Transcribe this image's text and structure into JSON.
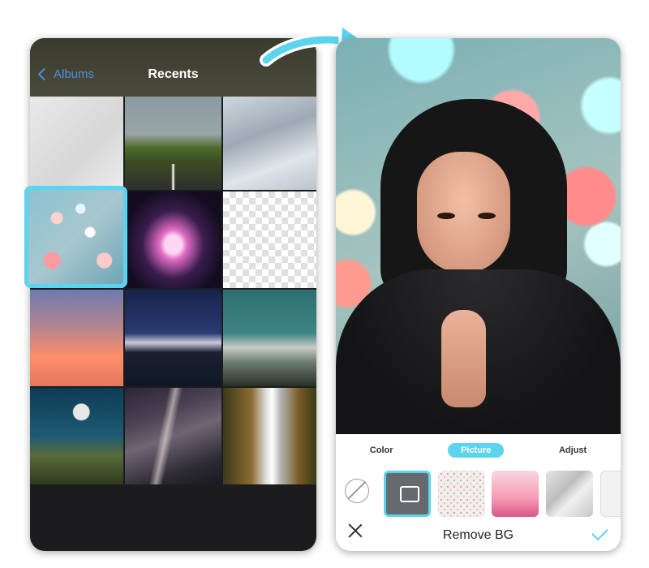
{
  "left_screen": {
    "back_label": "Albums",
    "title": "Recents",
    "photos": [
      {
        "name": "photo-gray-sky"
      },
      {
        "name": "photo-mountain-road"
      },
      {
        "name": "photo-clouds"
      },
      {
        "name": "photo-bokeh"
      },
      {
        "name": "photo-neon-x"
      },
      {
        "name": "photo-transparent"
      },
      {
        "name": "photo-pink-sunset"
      },
      {
        "name": "photo-night-mountain"
      },
      {
        "name": "photo-teal-mountains"
      },
      {
        "name": "photo-moon-rocks"
      },
      {
        "name": "photo-milky-way"
      },
      {
        "name": "photo-waterfall"
      }
    ]
  },
  "right_screen": {
    "tabs": [
      {
        "label": "Color"
      },
      {
        "label": "Picture"
      },
      {
        "label": "Adjust"
      }
    ],
    "active_tab": "Picture",
    "bottom_title": "Remove BG"
  },
  "colors": {
    "accent": "#5cd4ee",
    "back_link": "#4a90e2"
  }
}
